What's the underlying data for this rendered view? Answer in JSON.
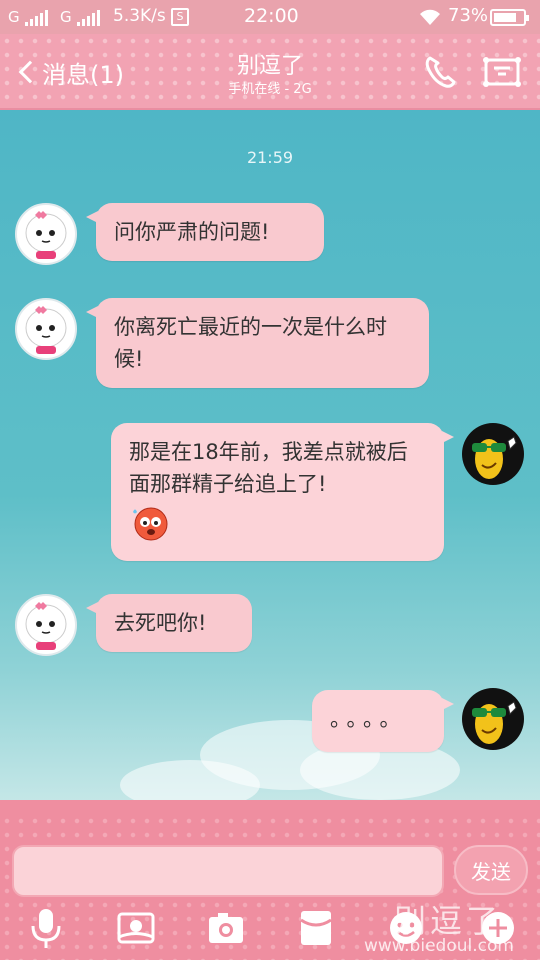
{
  "status_bar": {
    "sim1": "G",
    "sim2": "G",
    "net_speed": "5.3K/s",
    "time": "22:00",
    "battery": "73%"
  },
  "header": {
    "back_label": "消息(1)",
    "title": "别逗了",
    "subtitle": "手机在线 - 2G"
  },
  "chat": {
    "timestamp": "21:59",
    "messages": [
      {
        "side": "left",
        "text": "问你严肃的问题!"
      },
      {
        "side": "left",
        "text": "你离死亡最近的一次是什么时候!"
      },
      {
        "side": "right",
        "text": "那是在18年前，我差点就被后面那群精子给追上了!"
      },
      {
        "side": "left",
        "text": "去死吧你!"
      },
      {
        "side": "right",
        "text": "。。。。"
      }
    ]
  },
  "footer": {
    "input_value": "",
    "send_label": "发送",
    "tools": [
      "microphone-icon",
      "image-icon",
      "camera-icon",
      "red-envelope-icon",
      "emoji-icon",
      "plus-icon"
    ]
  },
  "watermark": {
    "text": "别逗了",
    "url": "www.biedoul.com"
  },
  "colors": {
    "header_bg": "#f2a3b3",
    "bubble_bg": "#f9c9cf",
    "chat_bg": "#5ab8c4"
  }
}
